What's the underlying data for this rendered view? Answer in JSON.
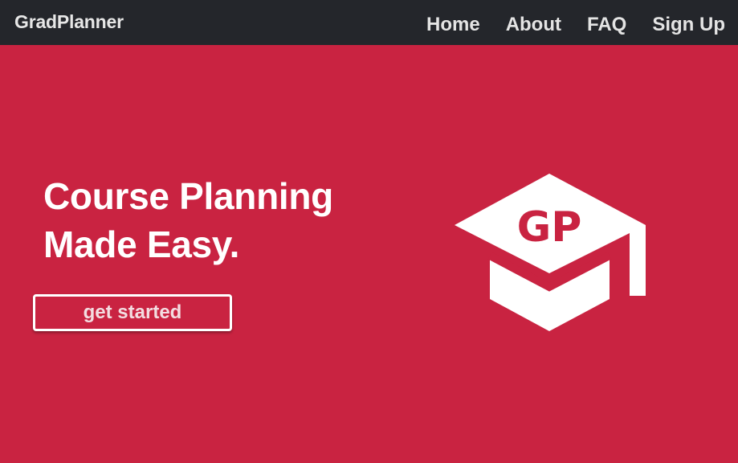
{
  "navbar": {
    "brand": "GradPlanner",
    "links": [
      {
        "label": "Home"
      },
      {
        "label": "About"
      },
      {
        "label": "FAQ"
      },
      {
        "label": "Sign Up"
      }
    ]
  },
  "hero": {
    "title_line1": "Course Planning",
    "title_line2": "Made Easy.",
    "cta_label": "get started",
    "logo": {
      "icon": "graduation-cap-icon",
      "text": "GP"
    }
  },
  "colors": {
    "navbar_bg": "#24262b",
    "hero_bg": "#c92341",
    "text": "#ffffff"
  }
}
